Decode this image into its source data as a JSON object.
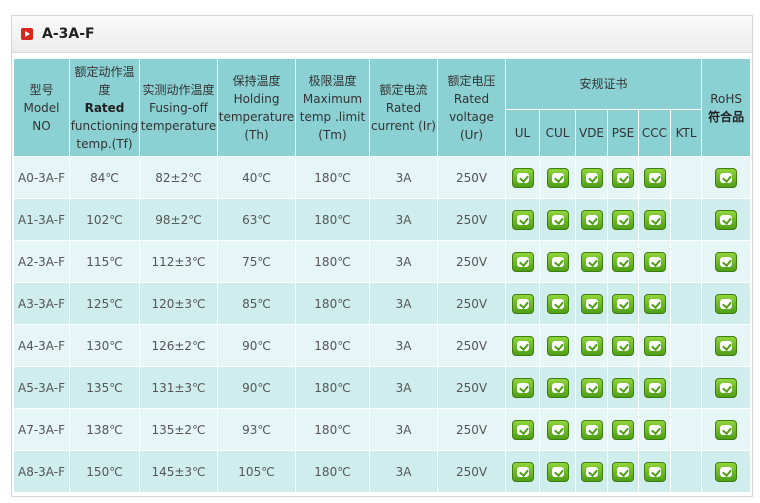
{
  "panel": {
    "title": "A-3A-F"
  },
  "headers": {
    "model": [
      "型号",
      "Model",
      "NO"
    ],
    "rated_temp": {
      "zh": "额定动作温度",
      "en_bold": "Rated",
      "en": "functioning temp.(Tf)"
    },
    "fusing_temp": {
      "zh": "实测动作温度",
      "en": "Fusing-off temperature"
    },
    "holding_temp": {
      "zh": "保持温度",
      "en": "Holding temperature (Th)"
    },
    "max_temp": {
      "zh": "极限温度",
      "en": "Maximum temp .limit (Tm)"
    },
    "rated_current": {
      "zh": "额定电流",
      "en": "Rated current (Ir)"
    },
    "rated_voltage": {
      "zh": "额定电压",
      "en": "Rated voltage (Ur)"
    },
    "certs": "安规证书",
    "cert_names": [
      "UL",
      "CUL",
      "VDE",
      "PSE",
      "CCC",
      "KTL"
    ],
    "rohs": [
      "RoHS",
      "符合品"
    ]
  },
  "rows": [
    {
      "model": "A0-3A-F",
      "tf": "84℃",
      "fusing": "82±2℃",
      "th": "40℃",
      "tm": "180℃",
      "ir": "3A",
      "ur": "250V"
    },
    {
      "model": "A1-3A-F",
      "tf": "102℃",
      "fusing": "98±2℃",
      "th": "63℃",
      "tm": "180℃",
      "ir": "3A",
      "ur": "250V"
    },
    {
      "model": "A2-3A-F",
      "tf": "115℃",
      "fusing": "112±3℃",
      "th": "75℃",
      "tm": "180℃",
      "ir": "3A",
      "ur": "250V"
    },
    {
      "model": "A3-3A-F",
      "tf": "125℃",
      "fusing": "120±3℃",
      "th": "85℃",
      "tm": "180℃",
      "ir": "3A",
      "ur": "250V"
    },
    {
      "model": "A4-3A-F",
      "tf": "130℃",
      "fusing": "126±2℃",
      "th": "90℃",
      "tm": "180℃",
      "ir": "3A",
      "ur": "250V"
    },
    {
      "model": "A5-3A-F",
      "tf": "135℃",
      "fusing": "131±3℃",
      "th": "90℃",
      "tm": "180℃",
      "ir": "3A",
      "ur": "250V"
    },
    {
      "model": "A7-3A-F",
      "tf": "138℃",
      "fusing": "135±2℃",
      "th": "93℃",
      "tm": "180℃",
      "ir": "3A",
      "ur": "250V"
    },
    {
      "model": "A8-3A-F",
      "tf": "150℃",
      "fusing": "145±3℃",
      "th": "105℃",
      "tm": "180℃",
      "ir": "3A",
      "ur": "250V"
    }
  ],
  "cert_marks": [
    "check-icon",
    "check-icon",
    "check-icon",
    "check-icon",
    "check-icon",
    ""
  ],
  "colors": {
    "header_bg": "#8bd1d3",
    "row_even": "#e6f5f6",
    "row_odd": "#d0eded",
    "badge": "#6fc02a",
    "title_icon": "#d9261c"
  }
}
